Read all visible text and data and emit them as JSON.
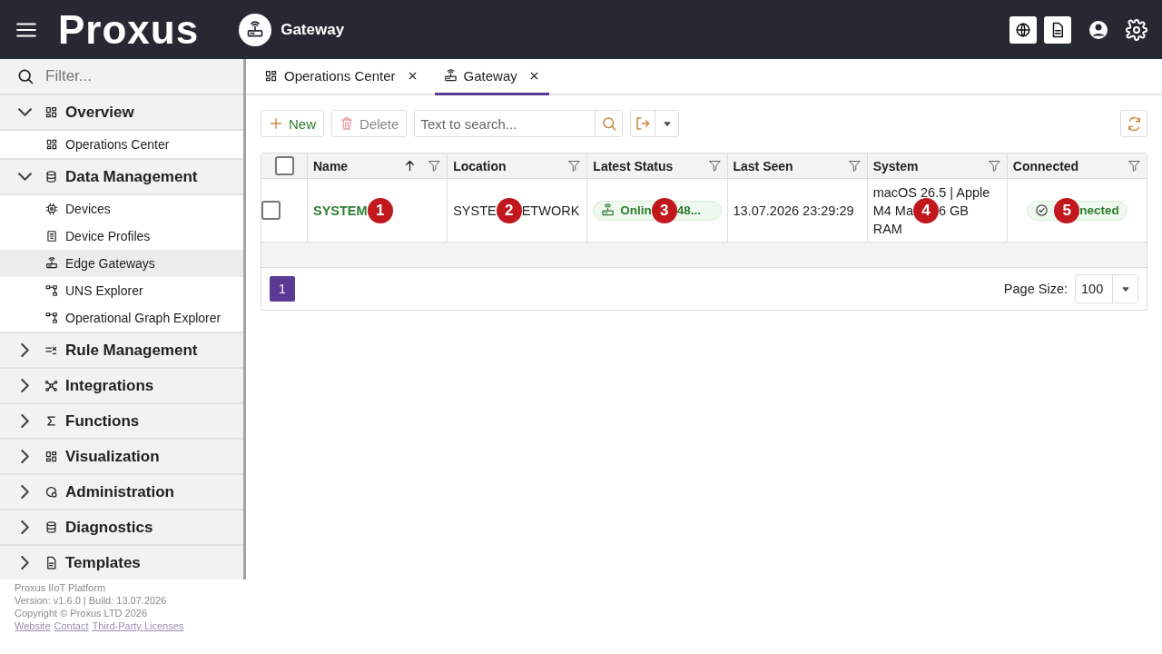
{
  "header": {
    "logo": "Proxus",
    "page_title": "Gateway"
  },
  "sidebar": {
    "filter_placeholder": "Filter...",
    "groups": [
      {
        "label": "Overview",
        "expanded": true,
        "children": [
          {
            "label": "Operations Center",
            "selected": false
          }
        ]
      },
      {
        "label": "Data Management",
        "expanded": true,
        "children": [
          {
            "label": "Devices",
            "selected": false
          },
          {
            "label": "Device Profiles",
            "selected": false
          },
          {
            "label": "Edge Gateways",
            "selected": true
          },
          {
            "label": "UNS Explorer",
            "selected": false
          },
          {
            "label": "Operational Graph Explorer",
            "selected": false
          }
        ]
      },
      {
        "label": "Rule Management",
        "expanded": false
      },
      {
        "label": "Integrations",
        "expanded": false
      },
      {
        "label": "Functions",
        "expanded": false
      },
      {
        "label": "Visualization",
        "expanded": false
      },
      {
        "label": "Administration",
        "expanded": false
      },
      {
        "label": "Diagnostics",
        "expanded": false
      },
      {
        "label": "Templates",
        "expanded": false
      }
    ],
    "footer": {
      "product": "Proxus IIoT Platform",
      "version": "Version: v1.6.0 | Build: 13.07.2026",
      "copyright": "Copyright © Proxus LTD 2026",
      "links": [
        "Website",
        "Contact",
        "Third-Party Licenses"
      ]
    }
  },
  "tabs": [
    {
      "label": "Operations Center",
      "selected": false
    },
    {
      "label": "Gateway",
      "selected": true
    }
  ],
  "toolbar": {
    "new": "New",
    "delete": "Delete",
    "delete_disabled": true,
    "search_placeholder": "Text to search..."
  },
  "table": {
    "all_checked": false,
    "columns": [
      {
        "label": "Name",
        "sorted": true
      },
      {
        "label": "Location",
        "sorted": false
      },
      {
        "label": "Latest Status",
        "sorted": false
      },
      {
        "label": "Last Seen",
        "sorted": false
      },
      {
        "label": "System",
        "sorted": false
      },
      {
        "label": "Connected",
        "sorted": false
      }
    ],
    "rows": [
      {
        "checked": false,
        "cells": [
          {
            "kind": "link",
            "lines": [
              [
                {
                  "text": "SYSTEM"
                },
                {
                  "marker": "1"
                }
              ]
            ]
          },
          {
            "kind": "text",
            "lines": [
              [
                {
                  "text": "SYSTE"
                },
                {
                  "marker": "2"
                },
                {
                  "text": "ETWORK"
                }
              ]
            ]
          },
          {
            "kind": "status",
            "lines": [
              [
                {
                  "text": "Onlin"
                },
                {
                  "marker": "3"
                },
                {
                  "text": "48..."
                }
              ]
            ]
          },
          {
            "kind": "text",
            "lines": [
              [
                {
                  "text": "13.07.2026 23:29:29"
                }
              ]
            ]
          },
          {
            "kind": "text",
            "lines": [
              [
                {
                  "text": "macOS 26.5 | Apple"
                }
              ],
              [
                {
                  "text": "M4 Ma"
                },
                {
                  "marker": "4"
                },
                {
                  "text": "6 GB"
                }
              ],
              [
                {
                  "text": "RAM"
                }
              ]
            ]
          },
          {
            "kind": "connected",
            "lines": [
              [
                {
                  "marker": "5"
                },
                {
                  "text": "nected"
                }
              ]
            ]
          }
        ]
      }
    ]
  },
  "pager": {
    "pages": [
      {
        "label": "1",
        "selected": true
      }
    ],
    "page_size_label": "Page Size:",
    "page_size": "100"
  }
}
